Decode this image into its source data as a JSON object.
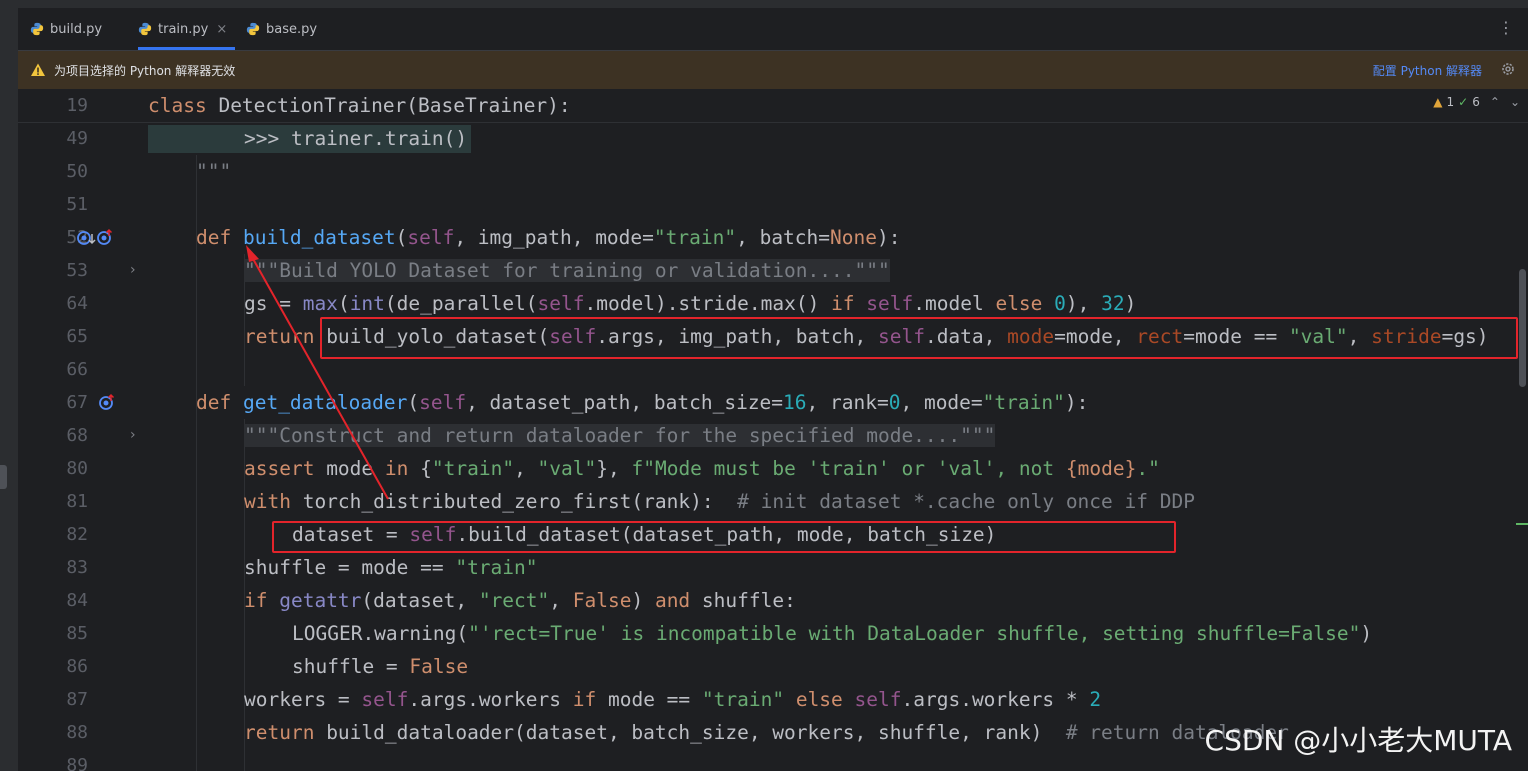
{
  "tabs": [
    {
      "label": "build.py",
      "active": false
    },
    {
      "label": "train.py",
      "active": true,
      "close": "×"
    },
    {
      "label": "base.py",
      "active": false
    }
  ],
  "banner": {
    "message": "为项目选择的 Python 解释器无效",
    "link": "配置 Python 解释器"
  },
  "inspection": {
    "warnings": "1",
    "ok": "6"
  },
  "line_numbers": [
    "19",
    "49",
    "50",
    "51",
    "52",
    "53",
    "64",
    "65",
    "66",
    "67",
    "68",
    "80",
    "81",
    "82",
    "83",
    "84",
    "85",
    "86",
    "87",
    "88",
    "89"
  ],
  "code": {
    "l19_kw": "class ",
    "l19_rest": "DetectionTrainer(BaseTrainer):",
    "l49": ">>> trainer.train()",
    "l50": "\"\"\"",
    "l52_def": "def ",
    "l52_fn": "build_dataset",
    "l52_p1": "(",
    "l52_self": "self",
    "l52_p2": ", img_path, mode=",
    "l52_str": "\"train\"",
    "l52_p3": ", batch=",
    "l52_none": "None",
    "l52_p4": "):",
    "l53": "\"\"\"Build YOLO Dataset for training or validation....\"\"\"",
    "l64_a": "gs = ",
    "l64_max": "max",
    "l64_b": "(",
    "l64_int": "int",
    "l64_c": "(de_parallel(",
    "l64_self1": "self",
    "l64_d": ".model).stride.max() ",
    "l64_if": "if ",
    "l64_self2": "self",
    "l64_e": ".model ",
    "l64_else": "else ",
    "l64_zero": "0",
    "l64_f": "), ",
    "l64_32": "32",
    "l64_g": ")",
    "l65_ret": "return ",
    "l65_a": "build_yolo_dataset(",
    "l65_self1": "self",
    "l65_b": ".args, img_path, batch, ",
    "l65_self2": "self",
    "l65_c": ".data, ",
    "l65_mode": "mode",
    "l65_d": "=mode, ",
    "l65_rect": "rect",
    "l65_e": "=mode == ",
    "l65_val": "\"val\"",
    "l65_f": ", ",
    "l65_stride": "stride",
    "l65_g": "=gs)",
    "l67_def": "def ",
    "l67_fn": "get_dataloader",
    "l67_a": "(",
    "l67_self": "self",
    "l67_b": ", dataset_path, batch_size=",
    "l67_16": "16",
    "l67_c": ", rank=",
    "l67_0": "0",
    "l67_d": ", mode=",
    "l67_str": "\"train\"",
    "l67_e": "):",
    "l68": "\"\"\"Construct and return dataloader for the specified mode....\"\"\"",
    "l80_assert": "assert ",
    "l80_a": "mode ",
    "l80_in": "in ",
    "l80_b": "{",
    "l80_s1": "\"train\"",
    "l80_c": ", ",
    "l80_s2": "\"val\"",
    "l80_d": "}, ",
    "l80_f": "f\"Mode must be 'train' or 'val', not ",
    "l80_e": "{mode}",
    "l80_g": ".\"",
    "l81_with": "with ",
    "l81_a": "torch_distributed_zero_first(rank):  ",
    "l81_cm": "# init dataset *.cache only once if DDP",
    "l82_a": "dataset = ",
    "l82_self": "self",
    "l82_b": ".build_dataset(dataset_path, mode, batch_size)",
    "l83_a": "shuffle = mode == ",
    "l83_s": "\"train\"",
    "l84_if": "if ",
    "l84_getattr": "getattr",
    "l84_a": "(dataset, ",
    "l84_s": "\"rect\"",
    "l84_b": ", ",
    "l84_false": "False",
    "l84_c": ") ",
    "l84_and": "and ",
    "l84_d": "shuffle:",
    "l85_a": "LOGGER.warning(",
    "l85_s": "\"'rect=True' is incompatible with DataLoader shuffle, setting shuffle=False\"",
    "l85_b": ")",
    "l86_a": "shuffle = ",
    "l86_false": "False",
    "l87_a": "workers = ",
    "l87_self1": "self",
    "l87_b": ".args.workers ",
    "l87_if": "if ",
    "l87_c": "mode == ",
    "l87_s": "\"train\" ",
    "l87_else": "else ",
    "l87_self2": "self",
    "l87_d": ".args.workers * ",
    "l87_2": "2",
    "l88_ret": "return ",
    "l88_a": "build_dataloader(dataset, batch_size, workers, shuffle, rank)  ",
    "l88_cm": "# return dataloader"
  },
  "watermark": "CSDN @小小老大MUTA",
  "colors": {
    "accent": "#3574f0",
    "annotation_red": "#e3242b",
    "banner_bg": "#3d3223"
  }
}
